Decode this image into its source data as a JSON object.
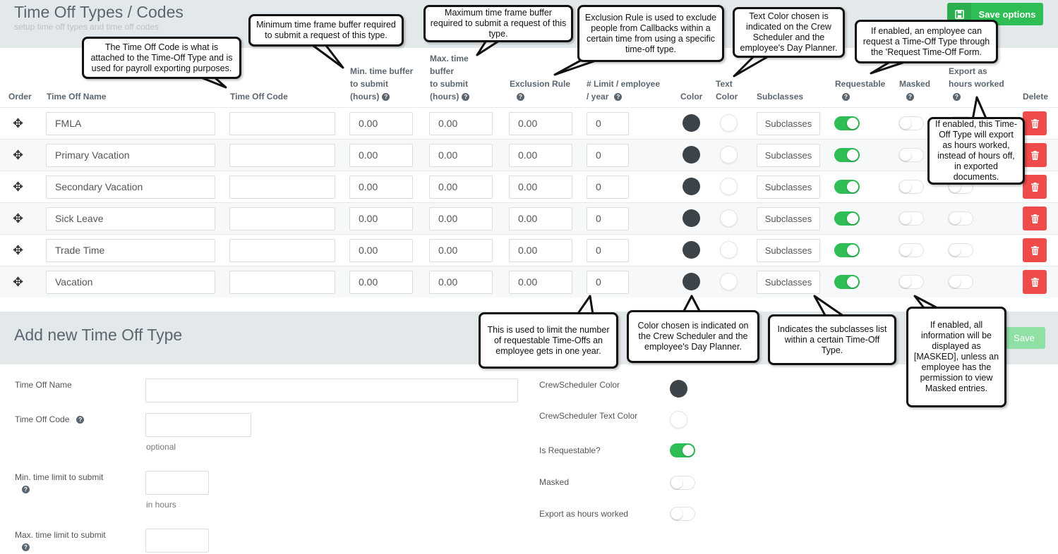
{
  "header": {
    "title": "Time Off Types / Codes",
    "subtitle": "setup time off types and time off codes",
    "save_options": "Save options"
  },
  "columns": {
    "order": "Order",
    "name": "Time Off Name",
    "code": "Time Off Code",
    "min_1": "Min. time buffer",
    "min_2": "to submit",
    "min_3": "(hours)",
    "max_1": "Max. time",
    "max_2": "buffer",
    "max_3": "to submit",
    "max_4": "(hours)",
    "exclusion": "Exclusion Rule",
    "limit_1": "# Limit / employee",
    "limit_2": "/ year",
    "color": "Color",
    "text_color_1": "Text",
    "text_color_2": "Color",
    "subclasses": "Subclasses",
    "requestable": "Requestable",
    "masked": "Masked",
    "export_1": "Export as",
    "export_2": "hours worked",
    "delete": "Delete"
  },
  "rows": [
    {
      "name": "FMLA",
      "code": "",
      "min": "0.00",
      "max": "0.00",
      "exclusion": "0.00",
      "limit": "0",
      "color": "#3c4449",
      "text_color": "#ffffff",
      "subclasses": "Subclasses",
      "requestable": true,
      "masked": false,
      "export": false
    },
    {
      "name": "Primary Vacation",
      "code": "",
      "min": "0.00",
      "max": "0.00",
      "exclusion": "0.00",
      "limit": "0",
      "color": "#3c4449",
      "text_color": "#ffffff",
      "subclasses": "Subclasses",
      "requestable": true,
      "masked": false,
      "export": false
    },
    {
      "name": "Secondary  Vacation",
      "code": "",
      "min": "0.00",
      "max": "0.00",
      "exclusion": "0.00",
      "limit": "0",
      "color": "#3c4449",
      "text_color": "#ffffff",
      "subclasses": "Subclasses",
      "requestable": true,
      "masked": false,
      "export": false
    },
    {
      "name": "Sick Leave",
      "code": "",
      "min": "0.00",
      "max": "0.00",
      "exclusion": "0.00",
      "limit": "0",
      "color": "#3c4449",
      "text_color": "#ffffff",
      "subclasses": "Subclasses",
      "requestable": true,
      "masked": false,
      "export": false
    },
    {
      "name": "Trade Time",
      "code": "",
      "min": "0.00",
      "max": "0.00",
      "exclusion": "0.00",
      "limit": "0",
      "color": "#3c4449",
      "text_color": "#ffffff",
      "subclasses": "Subclasses",
      "requestable": true,
      "masked": false,
      "export": false
    },
    {
      "name": "Vacation",
      "code": "",
      "min": "0.00",
      "max": "0.00",
      "exclusion": "0.00",
      "limit": "0",
      "color": "#3c4449",
      "text_color": "#ffffff",
      "subclasses": "Subclasses",
      "requestable": true,
      "masked": false,
      "export": false
    }
  ],
  "add_form": {
    "title": "Add new Time Off Type",
    "save": "Save",
    "name_label": "Time Off Name",
    "code_label": "Time Off Code",
    "code_hint": "optional",
    "min_label": "Min. time limit to submit",
    "min_hint": "in hours",
    "max_label": "Max. time limit to submit",
    "cs_color_label": "CrewScheduler Color",
    "cs_text_color_label": "CrewScheduler Text Color",
    "requestable_label": "Is Requestable?",
    "masked_label": "Masked",
    "export_label": "Export as hours worked",
    "cs_color": "#3c4449",
    "cs_text_color": "#ffffff",
    "requestable": true,
    "masked": false,
    "export": false
  },
  "callouts": {
    "code": "The Time Off Code is what is attached to the Time-Off Type and is used for payroll exporting purposes.",
    "min": "Minimum time frame buffer required to submit a request of this type.",
    "max": "Maximum time frame buffer required to submit a request of this type.",
    "exclusion": "Exclusion Rule is used to exclude people from Callbacks within a certain time from using a specific time-off type.",
    "text_color": "Text Color chosen is indicated on the Crew Scheduler and the employee's Day Planner.",
    "requestable": "If enabled, an employee can request a Time-Off Type through the 'Request Time-Off Form.",
    "export": "If enabled, this Time-Off Type will export as hours worked, instead of hours off, in exported documents.",
    "limit": "This is used to limit the number of requestable Time-Offs an employee gets in one year.",
    "color": "Color chosen is indicated on the Crew Scheduler and the employee's Day Planner.",
    "subclasses": "Indicates the subclasses list within a certain Time-Off Type.",
    "masked": "If enabled, all information will be displayed as [MASKED], unless an employee has the permission to view Masked entries."
  }
}
